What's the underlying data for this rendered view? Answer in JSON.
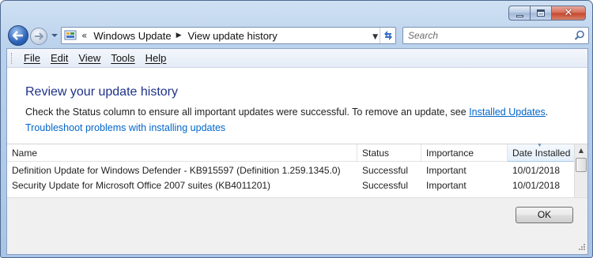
{
  "navbar": {
    "breadcrumb_overflow": "«",
    "breadcrumb": [
      "Windows Update",
      "View update history"
    ],
    "search_placeholder": "Search"
  },
  "menu": [
    {
      "label": "File"
    },
    {
      "label": "Edit"
    },
    {
      "label": "View"
    },
    {
      "label": "Tools"
    },
    {
      "label": "Help"
    }
  ],
  "page": {
    "title": "Review your update history",
    "description_prefix": "Check the Status column to ensure all important updates were successful. To remove an update, see ",
    "installed_updates_link": "Installed Updates",
    "description_suffix": ".",
    "troubleshoot_link": "Troubleshoot problems with installing updates"
  },
  "table": {
    "columns": [
      "Name",
      "Status",
      "Importance",
      "Date Installed"
    ],
    "sorted_column": "Date Installed",
    "rows": [
      {
        "name": "Definition Update for Windows Defender - KB915597 (Definition 1.259.1345.0)",
        "status": "Successful",
        "importance": "Important",
        "date": "10/01/2018"
      },
      {
        "name": "Security Update for Microsoft Office 2007 suites (KB4011201)",
        "status": "Successful",
        "importance": "Important",
        "date": "10/01/2018"
      }
    ]
  },
  "footer": {
    "ok_label": "OK"
  },
  "colors": {
    "title_blue": "#1e3287",
    "link_blue": "#0066cc",
    "chrome_blue": "#b9d1ec"
  }
}
